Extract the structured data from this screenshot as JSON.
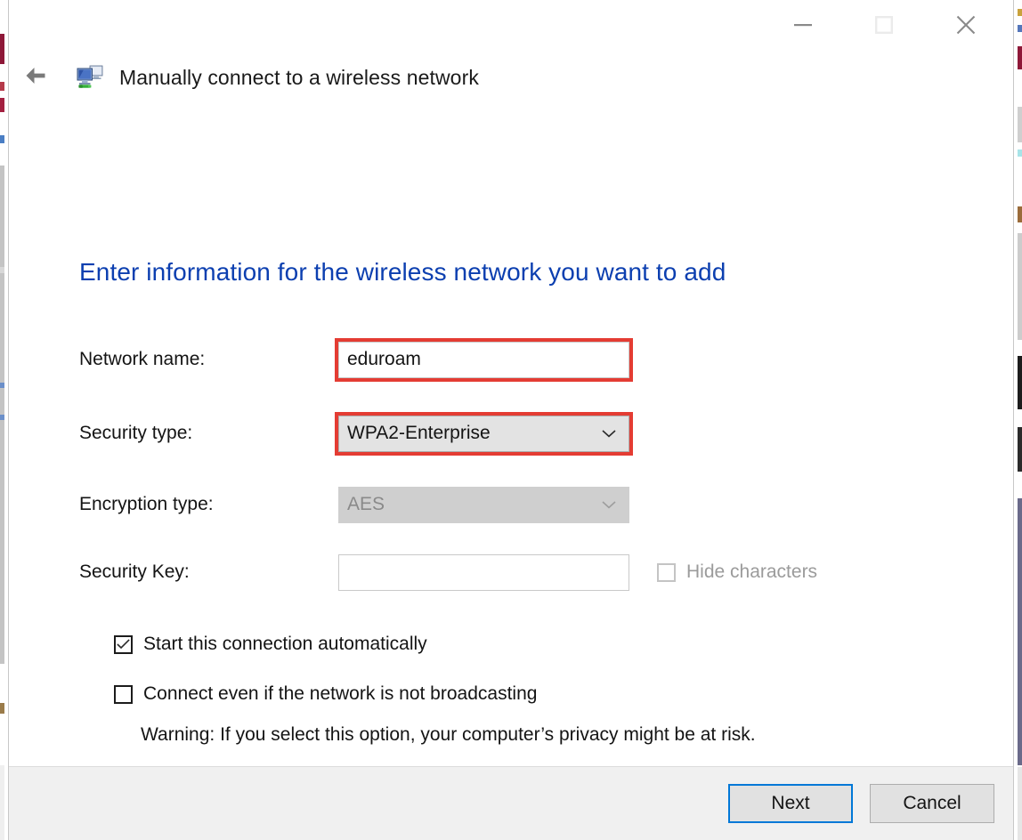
{
  "window": {
    "title": "Manually connect to a wireless network",
    "app_icon": "network-computers-icon",
    "back_arrow": "back-arrow-icon",
    "caption": {
      "minimize": "minimize-icon",
      "maximize": "maximize-icon",
      "close": "close-icon"
    }
  },
  "page": {
    "heading": "Enter information for the wireless network you want to add"
  },
  "form": {
    "network_name": {
      "label": "Network name:",
      "value": "eduroam",
      "placeholder": "",
      "highlighted": true
    },
    "security_type": {
      "label": "Security type:",
      "value": "WPA2-Enterprise",
      "highlighted": true,
      "disabled": false
    },
    "encryption_type": {
      "label": "Encryption type:",
      "value": "AES",
      "highlighted": false,
      "disabled": true
    },
    "security_key": {
      "label": "Security Key:",
      "value": "",
      "placeholder": "",
      "highlighted": false
    },
    "hide_characters": {
      "label": "Hide characters",
      "checked": false,
      "disabled": true
    }
  },
  "options": {
    "start_automatically": {
      "label": "Start this connection automatically",
      "checked": true
    },
    "connect_not_broadcasting": {
      "label": "Connect even if the network is not broadcasting",
      "checked": false
    },
    "warning": "Warning: If you select this option, your computer’s privacy might be at risk."
  },
  "footer": {
    "next_label": "Next",
    "cancel_label": "Cancel"
  },
  "colors": {
    "heading_blue": "#0c3fb0",
    "highlight_red": "#e43c33",
    "focus_blue": "#0078d7",
    "footer_bg": "#f0f0f0",
    "disabled_grey": "#cfcfcf"
  }
}
